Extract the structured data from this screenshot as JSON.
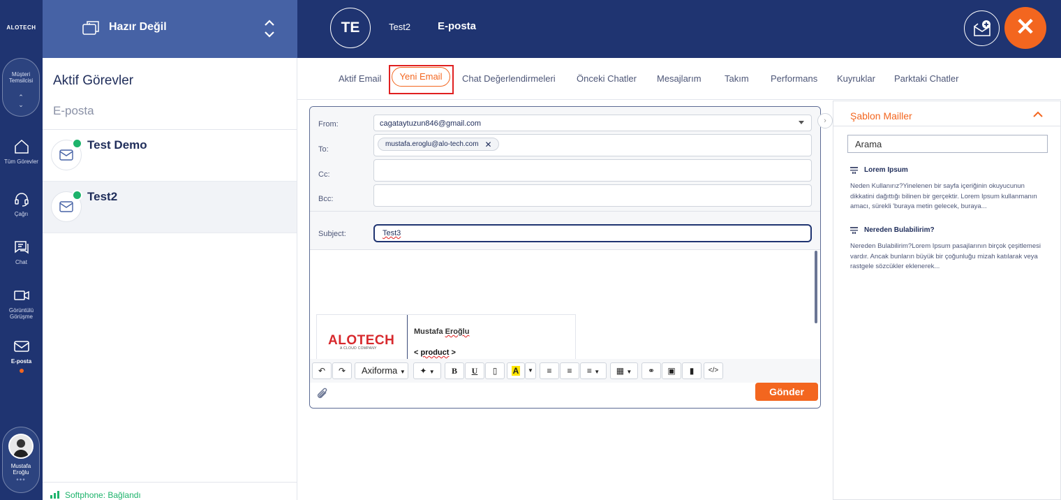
{
  "rail": {
    "brand": "ALOTECH",
    "role_label": "Müşteri Temsilcisi",
    "nav": [
      {
        "label": "Tüm Görevler",
        "icon": "home-icon"
      },
      {
        "label": "Çağrı",
        "icon": "headset-icon"
      },
      {
        "label": "Chat",
        "icon": "chat-icon"
      },
      {
        "label": "Görüntülü Görüşme",
        "icon": "video-icon"
      },
      {
        "label": "E-posta",
        "icon": "mail-icon"
      }
    ],
    "user_name": "Mustafa Eroğlu"
  },
  "status": {
    "label": "Hazır Değil"
  },
  "tasks": {
    "title": "Aktif Görevler",
    "subtitle": "E-posta",
    "items": [
      {
        "name": "Test Demo"
      },
      {
        "name": "Test2"
      }
    ],
    "softphone": "Softphone: Bağlandı"
  },
  "topbar": {
    "initials": "TE",
    "contact_name": "Test2",
    "channel": "E-posta"
  },
  "tabs": [
    {
      "label": "Aktif Email"
    },
    {
      "label": "Yeni Email",
      "active": true
    },
    {
      "label": "Chat Değerlendirmeleri"
    },
    {
      "label": "Önceki Chatler"
    },
    {
      "label": "Mesajlarım"
    },
    {
      "label": "Takım"
    },
    {
      "label": "Performans"
    },
    {
      "label": "Kuyruklar"
    },
    {
      "label": "Parktaki Chatler"
    }
  ],
  "compose": {
    "from_label": "From:",
    "from_value": "cagataytuzun846@gmail.com",
    "to_label": "To:",
    "to_chip": "mustafa.eroglu@alo-tech.com",
    "cc_label": "Cc:",
    "bcc_label": "Bcc:",
    "subject_label": "Subject:",
    "subject_value": "Test3",
    "signature": {
      "logo_text": "ALOTECH",
      "logo_sub": "A CLOUD COMPANY",
      "name_first": "Mustafa",
      "name_last": "Eroğlu",
      "product_prefix": "< ",
      "product_word": "product",
      "product_suffix": " >"
    },
    "font_select": "Axiforma",
    "send_label": "Gönder"
  },
  "templates": {
    "title": "Şablon Mailler",
    "search_value": "Arama",
    "items": [
      {
        "title": "Lorem Ipsum",
        "desc": "Neden Kullanırız?Yinelenen bir sayfa içeriğinin okuyucunun dikkatini dağıttığı bilinen bir gerçektir. Lorem Ipsum kullanmanın amacı, sürekli 'buraya metin gelecek, buraya..."
      },
      {
        "title": "Nereden Bulabilirim?",
        "desc": "Nereden Bulabilirim?Lorem Ipsum pasajlarının birçok çeşitlemesi vardır. Ancak bunların büyük bir çoğunluğu mizah katılarak veya rastgele sözcükler eklenerek..."
      }
    ]
  },
  "colors": {
    "navy": "#1f3471",
    "status_blue": "#4662a5",
    "accent_orange": "#f3661f",
    "online_green": "#1db36b",
    "highlight_red": "#e02020"
  }
}
